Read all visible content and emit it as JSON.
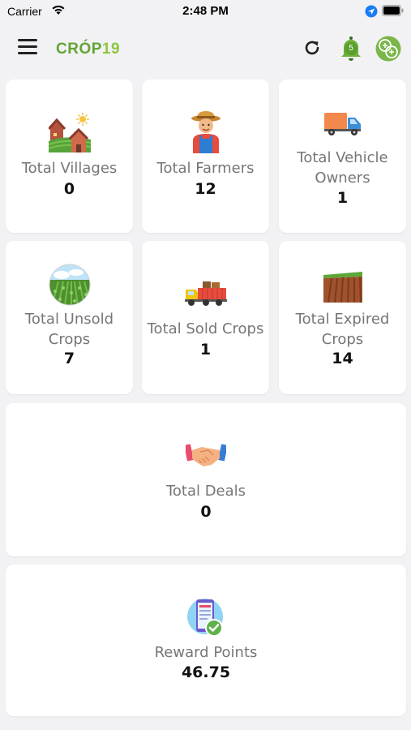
{
  "status_bar": {
    "carrier": "Carrier",
    "time": "2:48 PM"
  },
  "header": {
    "logo_text": "CRÓP",
    "logo_number": "19",
    "notification_count": "5",
    "brand_color": "#62a536"
  },
  "cards": [
    {
      "label": "Total Villages",
      "value": "0",
      "icon": "village-icon"
    },
    {
      "label": "Total Farmers",
      "value": "12",
      "icon": "farmer-icon"
    },
    {
      "label": "Total Vehicle Owners",
      "value": "1",
      "icon": "truck-icon"
    },
    {
      "label": "Total Unsold Crops",
      "value": "7",
      "icon": "crop-field-icon"
    },
    {
      "label": "Total Sold Crops",
      "value": "1",
      "icon": "loaded-truck-icon"
    },
    {
      "label": "Total Expired Crops",
      "value": "14",
      "icon": "plowed-field-icon"
    },
    {
      "label": "Total Deals",
      "value": "0",
      "icon": "handshake-icon"
    },
    {
      "label": "Reward Points",
      "value": "46.75",
      "icon": "reward-phone-icon"
    }
  ]
}
